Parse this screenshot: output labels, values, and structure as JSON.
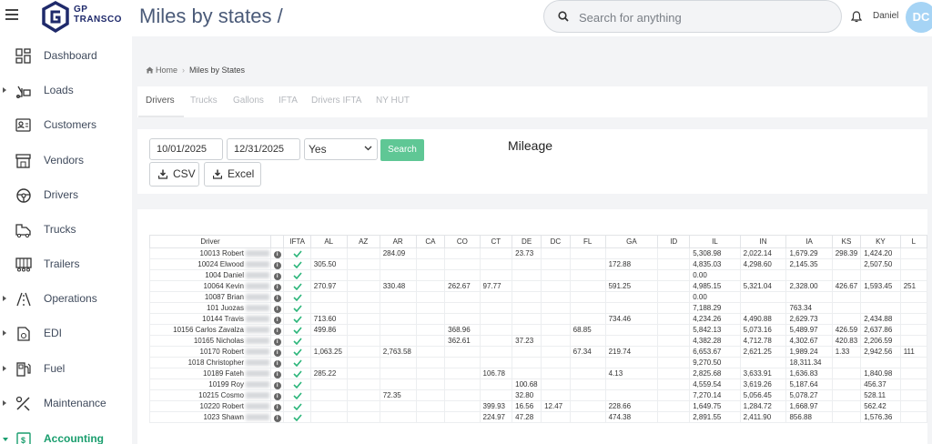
{
  "app": {
    "logo_line1": "GP",
    "logo_line2": "TRANSCO",
    "page_title": "Miles by states /",
    "brand_color": "#1f2a6b",
    "accent_color": "#1a9e6e"
  },
  "search": {
    "placeholder": "Search for anything"
  },
  "user": {
    "name": "Daniel",
    "initials": "DC"
  },
  "sidebar": {
    "items": [
      {
        "label": "Dashboard",
        "icon": "dashboard-icon",
        "has_caret": false
      },
      {
        "label": "Loads",
        "icon": "loads-icon",
        "has_caret": true
      },
      {
        "label": "Customers",
        "icon": "customers-icon",
        "has_caret": false
      },
      {
        "label": "Vendors",
        "icon": "vendors-icon",
        "has_caret": false
      },
      {
        "label": "Drivers",
        "icon": "drivers-icon",
        "has_caret": false
      },
      {
        "label": "Trucks",
        "icon": "trucks-icon",
        "has_caret": false
      },
      {
        "label": "Trailers",
        "icon": "trailers-icon",
        "has_caret": false
      },
      {
        "label": "Operations",
        "icon": "operations-icon",
        "has_caret": true
      },
      {
        "label": "EDI",
        "icon": "edi-icon",
        "has_caret": true
      },
      {
        "label": "Fuel",
        "icon": "fuel-icon",
        "has_caret": true
      },
      {
        "label": "Maintenance",
        "icon": "maintenance-icon",
        "has_caret": true
      },
      {
        "label": "Accounting",
        "icon": "accounting-icon",
        "has_caret": true,
        "active": true
      }
    ]
  },
  "breadcrumb": {
    "home": "Home",
    "current": "Miles by States"
  },
  "tabs": [
    "Drivers",
    "Trucks",
    "Gallons",
    "IFTA",
    "Drivers IFTA",
    "NY HUT"
  ],
  "filters": {
    "start_date": "10/01/2025",
    "end_date": "12/31/2025",
    "ifta_select": "Yes",
    "search_label": "Search",
    "csv_label": "CSV",
    "excel_label": "Excel"
  },
  "report_title": "Mileage",
  "table": {
    "columns": [
      "Driver",
      "IFTA",
      "AL",
      "AZ",
      "AR",
      "CA",
      "CO",
      "CT",
      "DE",
      "DC",
      "FL",
      "GA",
      "ID",
      "IL",
      "IN",
      "IA",
      "KS",
      "KY",
      "L"
    ],
    "rows": [
      {
        "driver": "10013 Robert",
        "ifta": true,
        "AL": "",
        "AZ": "",
        "AR": "284.09",
        "CA": "",
        "CO": "",
        "CT": "",
        "DE": "23.73",
        "DC": "",
        "FL": "",
        "GA": "",
        "ID": "",
        "IL": "5,308.98",
        "IN": "2,022.14",
        "IA": "1,679.29",
        "KS": "298.39",
        "KY": "1,424.20",
        "L": ""
      },
      {
        "driver": "10024 Elwood",
        "ifta": true,
        "AL": "305.50",
        "AZ": "",
        "AR": "",
        "CA": "",
        "CO": "",
        "CT": "",
        "DE": "",
        "DC": "",
        "FL": "",
        "GA": "172.88",
        "ID": "",
        "IL": "4,835.03",
        "IN": "4,298.60",
        "IA": "2,145.35",
        "KS": "",
        "KY": "2,507.50",
        "L": ""
      },
      {
        "driver": "1004 Daniel",
        "ifta": true,
        "AL": "",
        "AZ": "",
        "AR": "",
        "CA": "",
        "CO": "",
        "CT": "",
        "DE": "",
        "DC": "",
        "FL": "",
        "GA": "",
        "ID": "",
        "IL": "0.00",
        "IN": "",
        "IA": "",
        "KS": "",
        "KY": "",
        "L": ""
      },
      {
        "driver": "10064 Kevin",
        "ifta": true,
        "AL": "270.97",
        "AZ": "",
        "AR": "330.48",
        "CA": "",
        "CO": "262.67",
        "CT": "97.77",
        "DE": "",
        "DC": "",
        "FL": "",
        "GA": "591.25",
        "ID": "",
        "IL": "4,985.15",
        "IN": "5,321.04",
        "IA": "2,328.00",
        "KS": "426.67",
        "KY": "1,593.45",
        "L": "251"
      },
      {
        "driver": "10087 Brian",
        "ifta": true,
        "AL": "",
        "AZ": "",
        "AR": "",
        "CA": "",
        "CO": "",
        "CT": "",
        "DE": "",
        "DC": "",
        "FL": "",
        "GA": "",
        "ID": "",
        "IL": "0.00",
        "IN": "",
        "IA": "",
        "KS": "",
        "KY": "",
        "L": ""
      },
      {
        "driver": "101 Juozas",
        "ifta": true,
        "AL": "",
        "AZ": "",
        "AR": "",
        "CA": "",
        "CO": "",
        "CT": "",
        "DE": "",
        "DC": "",
        "FL": "",
        "GA": "",
        "ID": "",
        "IL": "7,188.29",
        "IN": "",
        "IA": "763.34",
        "KS": "",
        "KY": "",
        "L": ""
      },
      {
        "driver": "10144 Travis",
        "ifta": true,
        "AL": "713.60",
        "AZ": "",
        "AR": "",
        "CA": "",
        "CO": "",
        "CT": "",
        "DE": "",
        "DC": "",
        "FL": "",
        "GA": "734.46",
        "ID": "",
        "IL": "4,234.26",
        "IN": "4,490.88",
        "IA": "2,629.73",
        "KS": "",
        "KY": "2,434.88",
        "L": ""
      },
      {
        "driver": "10156 Carlos Zavalza",
        "ifta": true,
        "AL": "499.86",
        "AZ": "",
        "AR": "",
        "CA": "",
        "CO": "368.96",
        "CT": "",
        "DE": "",
        "DC": "",
        "FL": "68.85",
        "GA": "",
        "ID": "",
        "IL": "5,842.13",
        "IN": "5,073.16",
        "IA": "5,489.97",
        "KS": "426.59",
        "KY": "2,637.86",
        "L": ""
      },
      {
        "driver": "10165 Nicholas",
        "ifta": true,
        "AL": "",
        "AZ": "",
        "AR": "",
        "CA": "",
        "CO": "362.61",
        "CT": "",
        "DE": "37.23",
        "DC": "",
        "FL": "",
        "GA": "",
        "ID": "",
        "IL": "4,382.28",
        "IN": "4,712.78",
        "IA": "4,302.67",
        "KS": "420.83",
        "KY": "2,206.59",
        "L": ""
      },
      {
        "driver": "10170 Robert",
        "ifta": true,
        "AL": "1,063.25",
        "AZ": "",
        "AR": "2,763.58",
        "CA": "",
        "CO": "",
        "CT": "",
        "DE": "",
        "DC": "",
        "FL": "67.34",
        "GA": "219.74",
        "ID": "",
        "IL": "6,653.67",
        "IN": "2,621.25",
        "IA": "1,989.24",
        "KS": "1.33",
        "KY": "2,942.56",
        "L": "111"
      },
      {
        "driver": "1018 Christopher",
        "ifta": true,
        "AL": "",
        "AZ": "",
        "AR": "",
        "CA": "",
        "CO": "",
        "CT": "",
        "DE": "",
        "DC": "",
        "FL": "",
        "GA": "",
        "ID": "",
        "IL": "9,270.50",
        "IN": "",
        "IA": "18,311.34",
        "KS": "",
        "KY": "",
        "L": ""
      },
      {
        "driver": "10189 Fateh",
        "ifta": true,
        "AL": "285.22",
        "AZ": "",
        "AR": "",
        "CA": "",
        "CO": "",
        "CT": "106.78",
        "DE": "",
        "DC": "",
        "FL": "",
        "GA": "4.13",
        "ID": "",
        "IL": "2,825.68",
        "IN": "3,633.91",
        "IA": "1,636.83",
        "KS": "",
        "KY": "1,840.98",
        "L": ""
      },
      {
        "driver": "10199 Roy",
        "ifta": true,
        "AL": "",
        "AZ": "",
        "AR": "",
        "CA": "",
        "CO": "",
        "CT": "",
        "DE": "100.68",
        "DC": "",
        "FL": "",
        "GA": "",
        "ID": "",
        "IL": "4,559.54",
        "IN": "3,619.26",
        "IA": "5,187.64",
        "KS": "",
        "KY": "456.37",
        "L": ""
      },
      {
        "driver": "10215 Cosmo",
        "ifta": true,
        "AL": "",
        "AZ": "",
        "AR": "72.35",
        "CA": "",
        "CO": "",
        "CT": "",
        "DE": "32.80",
        "DC": "",
        "FL": "",
        "GA": "",
        "ID": "",
        "IL": "7,270.14",
        "IN": "5,056.45",
        "IA": "5,078.27",
        "KS": "",
        "KY": "528.11",
        "L": ""
      },
      {
        "driver": "10220 Robert",
        "ifta": true,
        "AL": "",
        "AZ": "",
        "AR": "",
        "CA": "",
        "CO": "",
        "CT": "399.93",
        "DE": "16.56",
        "DC": "12.47",
        "FL": "",
        "GA": "228.66",
        "ID": "",
        "IL": "1,649.75",
        "IN": "1,284.72",
        "IA": "1,668.97",
        "KS": "",
        "KY": "562.42",
        "L": ""
      },
      {
        "driver": "1023 Shawn",
        "ifta": true,
        "AL": "",
        "AZ": "",
        "AR": "",
        "CA": "",
        "CO": "",
        "CT": "224.97",
        "DE": "47.28",
        "DC": "",
        "FL": "",
        "GA": "474.38",
        "ID": "",
        "IL": "2,891.55",
        "IN": "2,411.90",
        "IA": "856.88",
        "KS": "",
        "KY": "1,576.36",
        "L": ""
      }
    ]
  }
}
